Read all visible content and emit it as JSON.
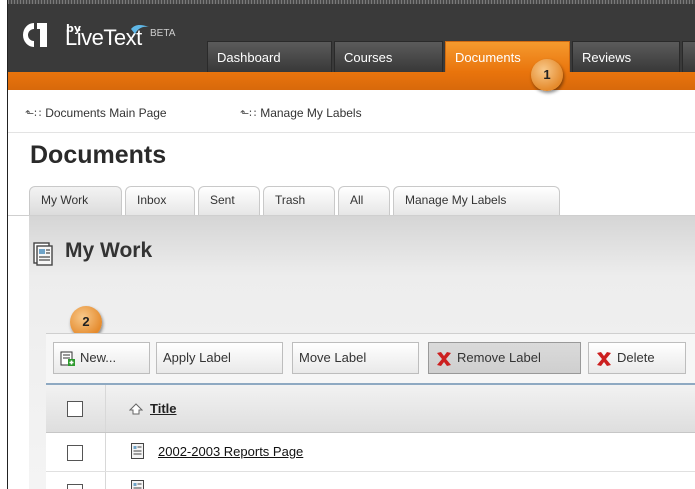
{
  "brand": {
    "by": "by",
    "name": "LiveText",
    "badge": "BETA"
  },
  "nav": {
    "tabs": [
      {
        "label": "Dashboard"
      },
      {
        "label": "Courses"
      },
      {
        "label": "Documents",
        "active": true
      },
      {
        "label": "Reviews"
      }
    ]
  },
  "callouts": [
    "1",
    "2"
  ],
  "breadcrumbs": [
    {
      "label": "Documents Main Page"
    },
    {
      "label": "Manage My Labels"
    }
  ],
  "page": {
    "title": "Documents",
    "section_title": "My Work"
  },
  "subtabs": [
    {
      "label": "My Work",
      "active": true
    },
    {
      "label": "Inbox"
    },
    {
      "label": "Sent"
    },
    {
      "label": "Trash"
    },
    {
      "label": "All"
    },
    {
      "label": "Manage My Labels"
    }
  ],
  "toolbar": {
    "new_label": "New...",
    "apply_label": "Apply Label",
    "move_label": "Move Label",
    "remove_label": "Remove Label",
    "delete_label": "Delete"
  },
  "table": {
    "header_title": "Title",
    "rows": [
      {
        "title": "2002-2003 Reports Page"
      }
    ]
  },
  "colors": {
    "accent_orange": "#e9740c",
    "header_dark": "#3a3a3a",
    "delete_red": "#cc1f1f"
  }
}
